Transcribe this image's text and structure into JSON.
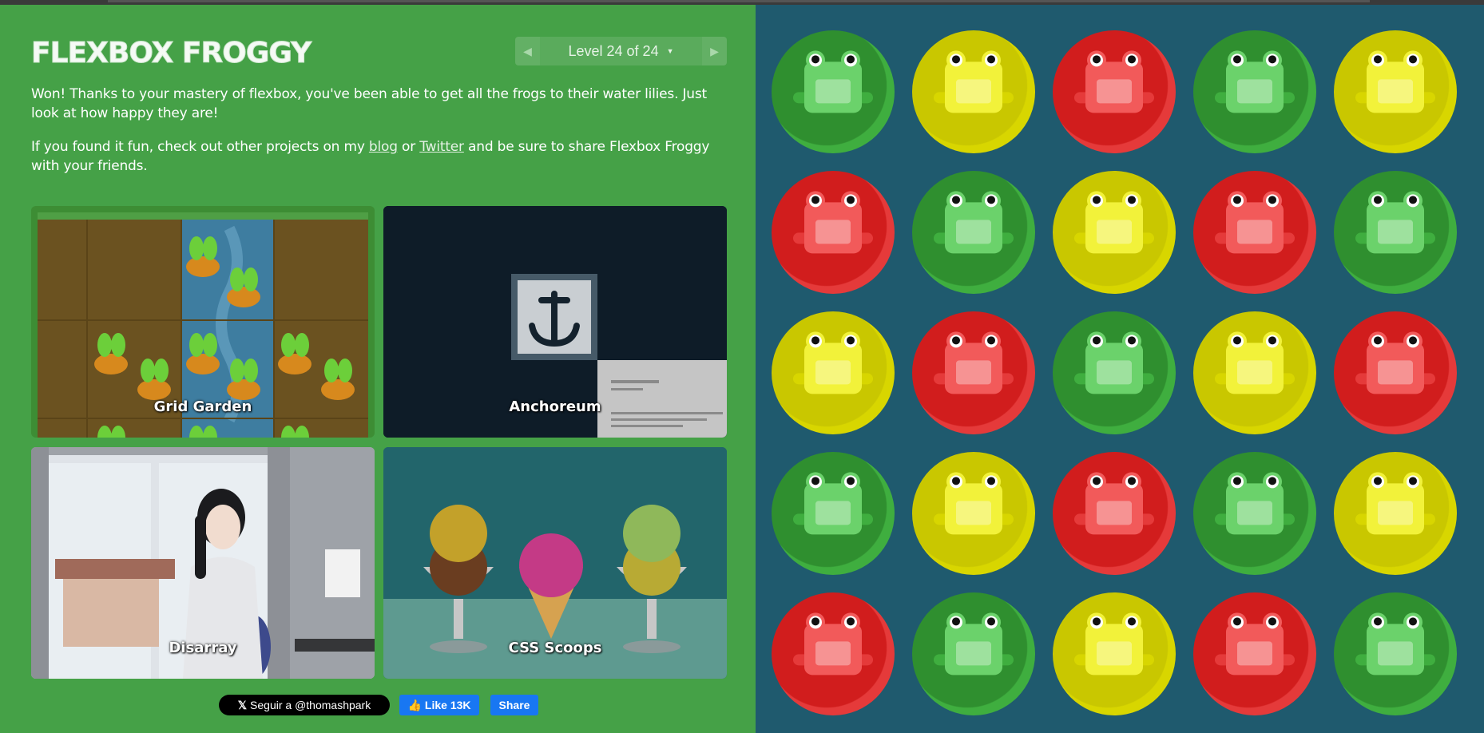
{
  "header": {
    "title": "FLEXBOX FROGGY",
    "level_text": "Level 24 of 24",
    "prev_icon": "arrow-left",
    "next_icon": "arrow-right",
    "dropdown_icon": "caret-down"
  },
  "message": {
    "won": "Won! Thanks to your mastery of flexbox, you've been able to get all the frogs to their water lilies. Just look at how happy they are!",
    "share_prefix": "If you found it fun, check out other projects on my",
    "blog_link": "blog",
    "or": "or",
    "twitter_link": "Twitter",
    "share_suffix": "and be sure to share Flexbox Froggy with your friends."
  },
  "projects": [
    {
      "label": "Grid Garden"
    },
    {
      "label": "Anchoreum"
    },
    {
      "label": "Disarray"
    },
    {
      "label": "CSS Scoops"
    }
  ],
  "social": {
    "twitter_follow": "Seguir a @thomashpark",
    "fb_like": "Like 13K",
    "fb_share": "Share"
  },
  "colors": {
    "sidebar": "#45a147",
    "pond": "#1f5a6e",
    "green_pad": "#2f8f2f",
    "yellow_pad": "#c9c700",
    "red_pad": "#d11d1d",
    "green_frog": "#6bd26b",
    "yellow_frog": "#f2f23a",
    "red_frog": "#f25a5a"
  },
  "board": [
    [
      "green",
      "yellow",
      "red",
      "green",
      "yellow"
    ],
    [
      "red",
      "green",
      "yellow",
      "red",
      "green"
    ],
    [
      "yellow",
      "red",
      "green",
      "yellow",
      "red"
    ],
    [
      "green",
      "yellow",
      "red",
      "green",
      "yellow"
    ],
    [
      "red",
      "green",
      "yellow",
      "red",
      "green"
    ]
  ]
}
